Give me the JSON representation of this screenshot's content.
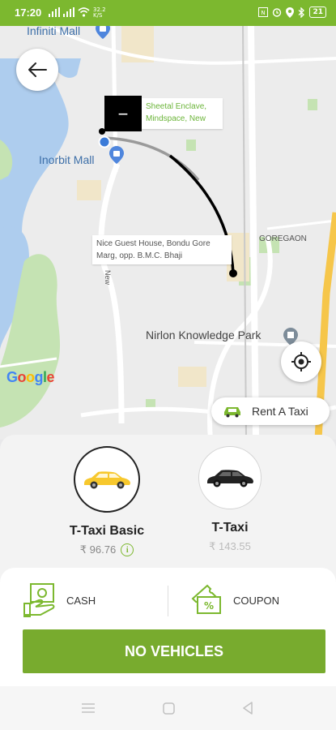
{
  "status_bar": {
    "time": "17:20",
    "left_icons": [
      "signal-icon",
      "signal-icon",
      "wifi-icon",
      "speed-icon"
    ],
    "network_speed": "32.2\nK/S",
    "battery": "21",
    "right_icons": [
      "nfc-icon",
      "alarm-icon",
      "location-icon",
      "bluetooth-icon",
      "battery-icon"
    ]
  },
  "map": {
    "labels": {
      "infiniti_mall": "Infiniti Mall",
      "inorbit_mall": "Inorbit Mall",
      "nirlon": "Nirlon Knowledge Park",
      "goregaon": "GOREGAON",
      "new": "New"
    },
    "pickup_marker_text": "—",
    "pickup_address": "Sheetal Enclave, Mindspace, New",
    "drop_address": "Nice Guest House, Bondu Gore Marg, opp. B.M.C. Bhaji",
    "google_logo": "Google",
    "rent_taxi_label": "Rent A Taxi",
    "colors": {
      "water": "#aecdee",
      "park": "#c5e3b3",
      "road": "#ffffff",
      "route": "#000000"
    }
  },
  "vehicles": [
    {
      "name": "T-Taxi Basic",
      "price": "₹ 96.76",
      "selected": true,
      "car_color": "#f7c82d",
      "icon": "car-yellow-icon"
    },
    {
      "name": "T-Taxi",
      "price": "₹ 143.55",
      "selected": false,
      "car_color": "#222222",
      "icon": "car-black-icon"
    }
  ],
  "payment": {
    "cash_label": "CASH",
    "coupon_label": "COUPON"
  },
  "main_button": {
    "label": "NO VEHICLES",
    "color": "#78ab2e"
  },
  "nav_bar": {
    "icons": [
      "menu-icon",
      "home-icon",
      "back-icon"
    ]
  }
}
